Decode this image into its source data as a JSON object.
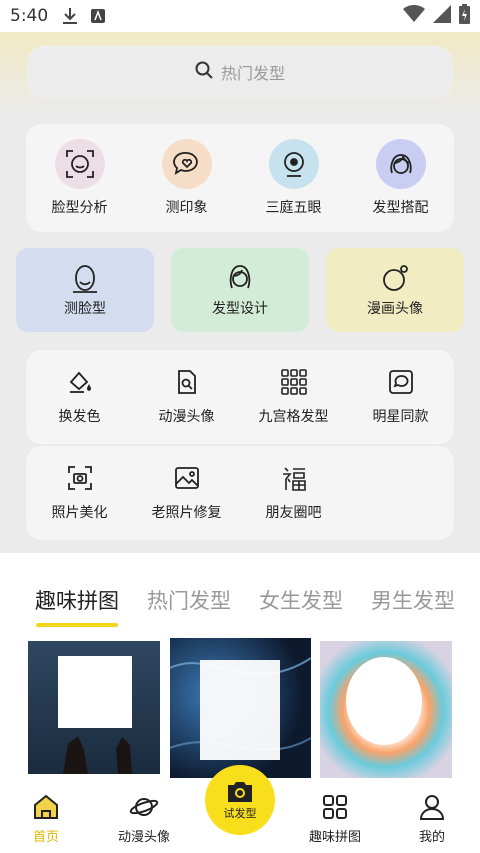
{
  "status": {
    "time": "5:40"
  },
  "search": {
    "placeholder": "热门发型"
  },
  "top_items": [
    {
      "label": "脸型分析",
      "color": "#eddde6"
    },
    {
      "label": "测印象",
      "color": "#f5ddc8"
    },
    {
      "label": "三庭五眼",
      "color": "#c7e2ef"
    },
    {
      "label": "发型搭配",
      "color": "#c9cdf2"
    }
  ],
  "features": [
    {
      "label": "测脸型",
      "color": "#d4ddef"
    },
    {
      "label": "发型设计",
      "color": "#d3ecd7"
    },
    {
      "label": "漫画头像",
      "color": "#f2ecc3"
    }
  ],
  "tools_row1": [
    {
      "label": "换发色"
    },
    {
      "label": "动漫头像"
    },
    {
      "label": "九宫格发型"
    },
    {
      "label": "明星同款"
    }
  ],
  "tools_row2": [
    {
      "label": "照片美化"
    },
    {
      "label": "老照片修复"
    },
    {
      "label": "朋友圈吧"
    }
  ],
  "tabs": [
    "趣味拼图",
    "热门发型",
    "女生发型",
    "男生发型"
  ],
  "nav": {
    "home": "首页",
    "anime": "动漫头像",
    "fab": "试发型",
    "puzzle": "趣味拼图",
    "mine": "我的"
  }
}
